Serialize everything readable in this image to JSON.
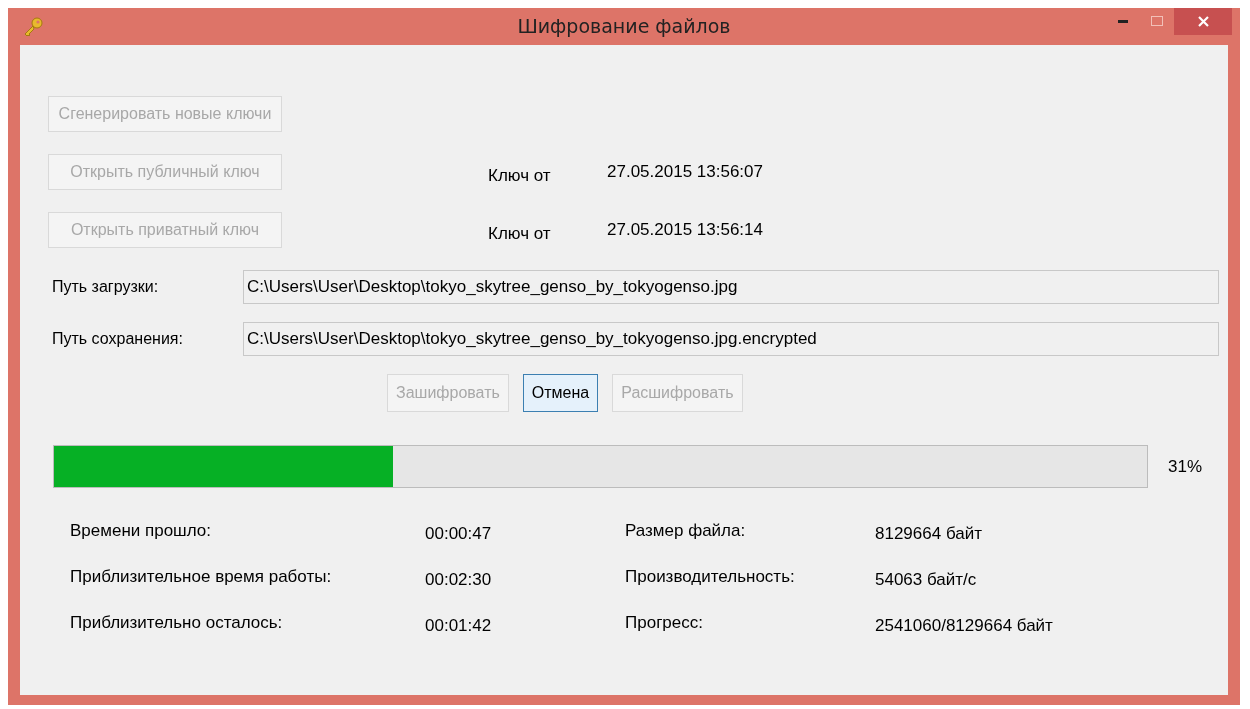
{
  "window": {
    "title": "Шифрование файлов"
  },
  "key_rows": [
    {
      "button": {
        "label": "Сгенерировать новые ключи",
        "disabled": true
      }
    },
    {
      "button": {
        "label": "Открыть публичный ключ",
        "disabled": true
      },
      "key_label": "Ключ от",
      "key_date": "27.05.2015 13:56:07"
    },
    {
      "button": {
        "label": "Открыть приватный ключ",
        "disabled": true
      },
      "key_label": "Ключ от",
      "key_date": "27.05.2015 13:56:14"
    }
  ],
  "paths": [
    {
      "label": "Путь загрузки:",
      "value": "C:\\Users\\User\\Desktop\\tokyo_skytree_genso_by_tokyogenso.jpg"
    },
    {
      "label": "Путь сохранения:",
      "value": "C:\\Users\\User\\Desktop\\tokyo_skytree_genso_by_tokyogenso.jpg.encrypted"
    }
  ],
  "actions": [
    {
      "label": "Зашифровать",
      "disabled": true,
      "focused": false
    },
    {
      "label": "Отмена",
      "disabled": false,
      "focused": true
    },
    {
      "label": "Расшифровать",
      "disabled": true,
      "focused": false
    }
  ],
  "progress": {
    "level": 0.31,
    "reading": "31%"
  },
  "stats": {
    "left": [
      {
        "label": "Времени прошло:",
        "value": "00:00:47"
      },
      {
        "label": "Приблизительное время работы:",
        "value": "00:02:30"
      },
      {
        "label": "Приблизительно осталось:",
        "value": "00:01:42"
      }
    ],
    "right": [
      {
        "label": "Размер файла:",
        "value": "8129664 байт"
      },
      {
        "label": "Производительность:",
        "value": "54063 байт/с"
      },
      {
        "label": "Прогресс:",
        "value": "2541060/8129664 байт"
      }
    ]
  }
}
